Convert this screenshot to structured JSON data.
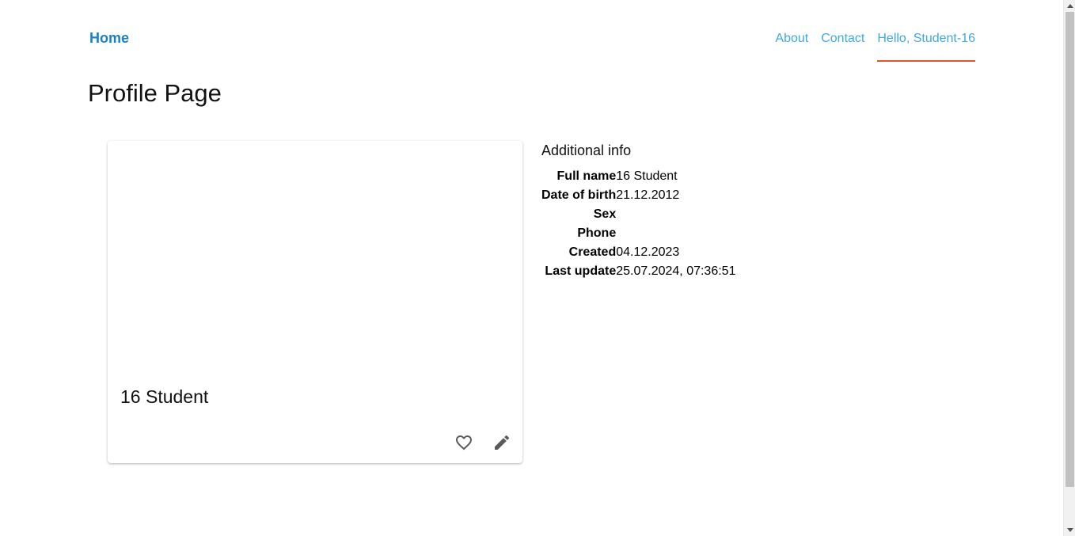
{
  "nav": {
    "home_label": "Home",
    "links": [
      {
        "label": "About"
      },
      {
        "label": "Contact"
      },
      {
        "label": "Hello, Student-16"
      }
    ]
  },
  "page": {
    "title": "Profile Page"
  },
  "card": {
    "name": "16 Student",
    "actions": {
      "favorite_icon": "heart-outline-icon",
      "edit_icon": "pencil-icon"
    }
  },
  "info": {
    "title": "Additional info",
    "rows": [
      {
        "key": "Full name",
        "value": "16 Student"
      },
      {
        "key": "Date of birth",
        "value": "21.12.2012"
      },
      {
        "key": "Sex",
        "value": ""
      },
      {
        "key": "Phone",
        "value": ""
      },
      {
        "key": "Created",
        "value": "04.12.2023"
      },
      {
        "key": "Last update",
        "value": "25.07.2024, 07:36:51"
      }
    ]
  },
  "colors": {
    "home_link": "#1a7fc9",
    "nav_link": "#3ea8e0",
    "active_underline": "#e0572b"
  }
}
